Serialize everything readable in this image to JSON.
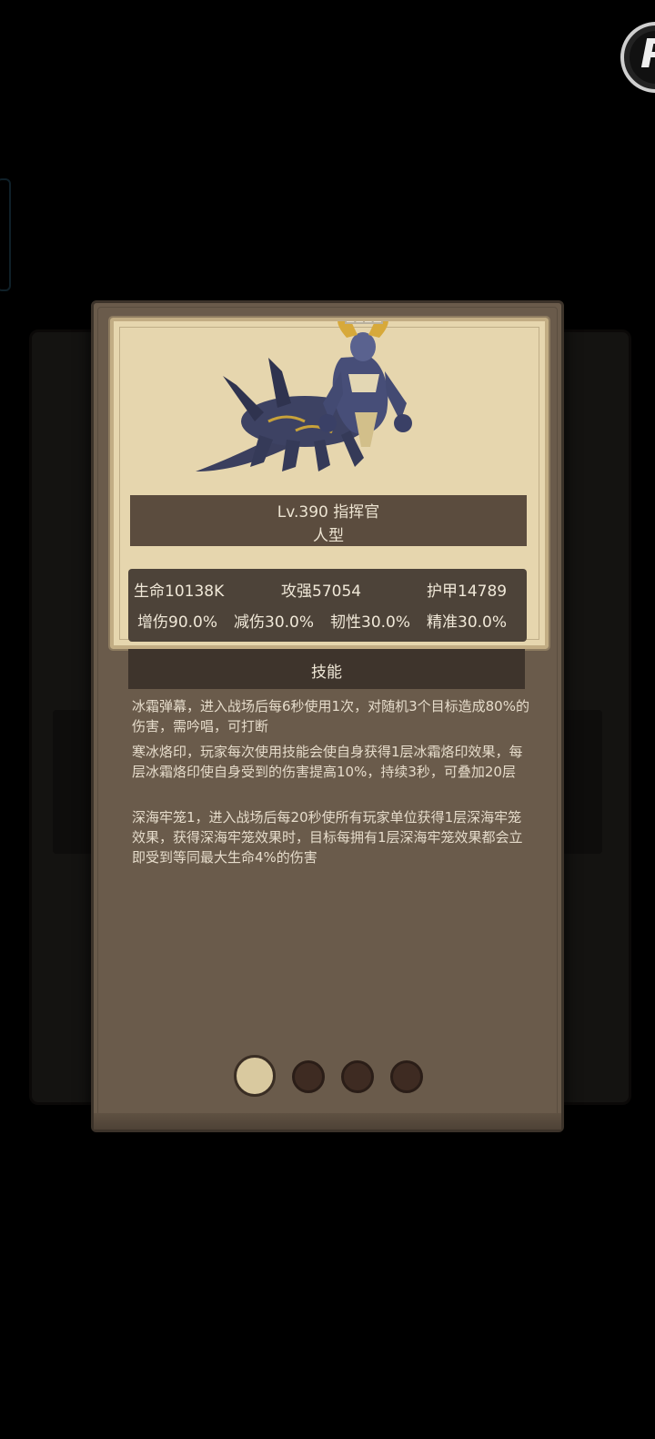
{
  "unit": {
    "level_title": "Lv.390 指挥官",
    "type": "人型"
  },
  "stats": {
    "hp": "生命10138K",
    "attack": "攻强57054",
    "armor": "护甲14789",
    "dmg_increase": "增伤90.0%",
    "dmg_reduction": "减伤30.0%",
    "toughness": "韧性30.0%",
    "accuracy": "精准30.0%"
  },
  "skills": {
    "header": "技能",
    "items": [
      "冰霜弹幕，进入战场后每6秒使用1次，对随机3个目标造成80%的伤害，需吟唱，可打断",
      "寒冰烙印，玩家每次使用技能会使自身获得1层冰霜烙印效果，每层冰霜烙印使自身受到的伤害提高10%，持续3秒，可叠加20层",
      "深海牢笼1，进入战场后每20秒使所有玩家单位获得1层深海牢笼效果，获得深海牢笼效果时，目标每拥有1层深海牢笼效果都会立即受到等同最大生命4%的伤害"
    ]
  },
  "pager": {
    "total": 4,
    "active_index": 0
  },
  "colors": {
    "card": "#6a5b4b",
    "portrait_bg": "#e6d6ae",
    "active_dot": "#d9c99f",
    "inactive_dot": "#3e2b22"
  }
}
